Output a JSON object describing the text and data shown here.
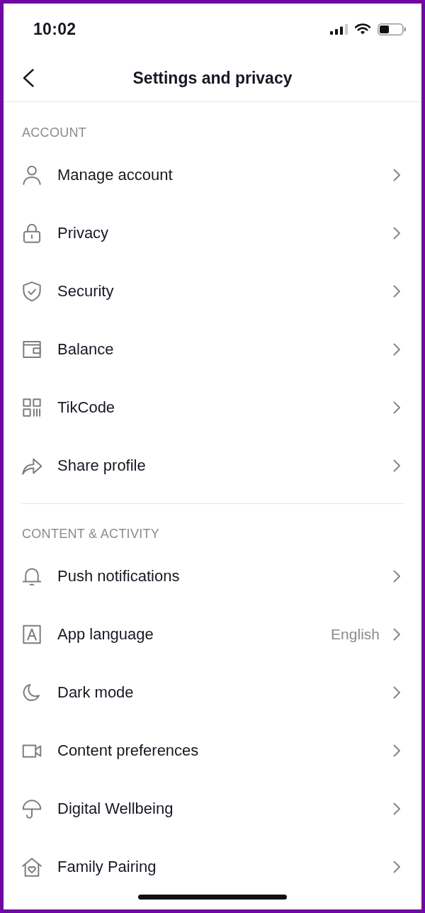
{
  "status_bar": {
    "time": "10:02"
  },
  "header": {
    "title": "Settings and privacy"
  },
  "sections": [
    {
      "heading": "ACCOUNT",
      "items": [
        {
          "label": "Manage account"
        },
        {
          "label": "Privacy"
        },
        {
          "label": "Security"
        },
        {
          "label": "Balance"
        },
        {
          "label": "TikCode"
        },
        {
          "label": "Share profile"
        }
      ]
    },
    {
      "heading": "CONTENT & ACTIVITY",
      "items": [
        {
          "label": "Push notifications"
        },
        {
          "label": "App language",
          "value": "English"
        },
        {
          "label": "Dark mode"
        },
        {
          "label": "Content preferences"
        },
        {
          "label": "Digital Wellbeing"
        },
        {
          "label": "Family Pairing"
        }
      ]
    }
  ]
}
